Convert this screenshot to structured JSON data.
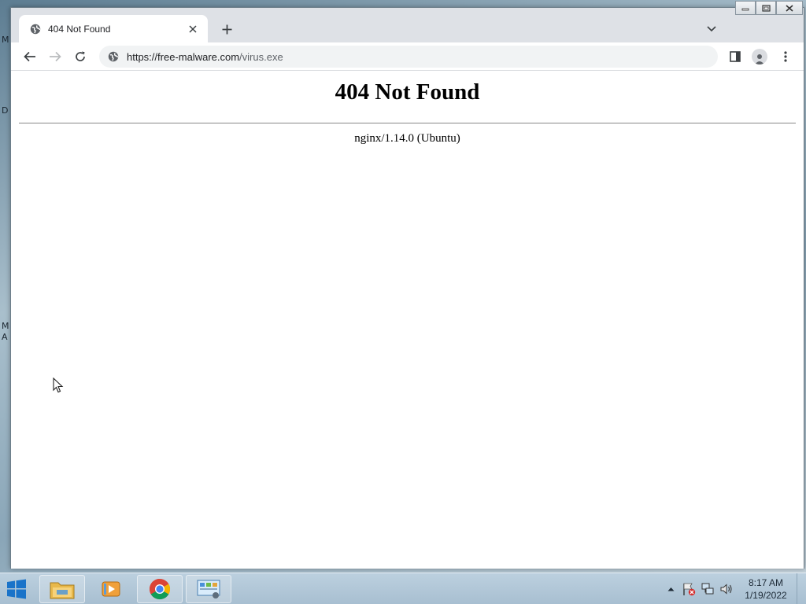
{
  "desktop": {
    "fragments": [
      "M",
      "D",
      "M",
      "A"
    ]
  },
  "window_controls": {
    "minimize": "minimize",
    "maximize": "maximize",
    "close": "close"
  },
  "tab": {
    "title": "404 Not Found",
    "favicon": "globe-icon",
    "close": "×"
  },
  "new_tab": "+",
  "toolbar": {
    "url_host": "https://free-malware.com",
    "url_path": "/virus.exe"
  },
  "page": {
    "heading": "404 Not Found",
    "server": "nginx/1.14.0 (Ubuntu)"
  },
  "taskbar": {
    "apps": [
      "File Explorer",
      "Windows Media Player",
      "Google Chrome",
      "Control Panel"
    ],
    "time": "8:17 AM",
    "date": "1/19/2022"
  }
}
